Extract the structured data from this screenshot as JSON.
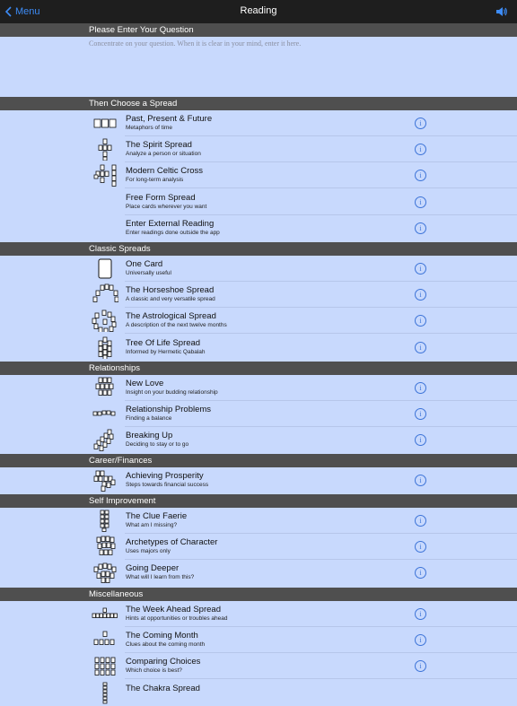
{
  "nav": {
    "back_label": "Menu",
    "title": "Reading"
  },
  "question": {
    "header": "Please Enter Your Question",
    "placeholder": "Concentrate on your question. When it is clear in your mind, enter it here.",
    "value": ""
  },
  "info_glyph": "i",
  "sections": [
    {
      "key": "spread",
      "title": "Then Choose a Spread",
      "items": [
        {
          "key": "past-present-future",
          "title": "Past, Present & Future",
          "subtitle": "Metaphors of time",
          "icon": "three-cards-icon"
        },
        {
          "key": "spirit",
          "title": "The Spirit Spread",
          "subtitle": "Analyze a person or situation",
          "icon": "spirit-spread-icon"
        },
        {
          "key": "celtic-cross",
          "title": "Modern Celtic Cross",
          "subtitle": "For long-term analysis",
          "icon": "celtic-cross-icon"
        },
        {
          "key": "free-form",
          "title": "Free Form Spread",
          "subtitle": "Place cards wherever you want",
          "icon": ""
        },
        {
          "key": "external",
          "title": "Enter External Reading",
          "subtitle": "Enter readings done outside the app",
          "icon": ""
        }
      ]
    },
    {
      "key": "classic",
      "title": "Classic Spreads",
      "items": [
        {
          "key": "one-card",
          "title": "One Card",
          "subtitle": "Universally useful",
          "icon": "single-card-icon"
        },
        {
          "key": "horseshoe",
          "title": "The Horseshoe Spread",
          "subtitle": "A classic and very versatile spread",
          "icon": "horseshoe-icon"
        },
        {
          "key": "astrological",
          "title": "The Astrological Spread",
          "subtitle": "A description of the next twelve months",
          "icon": "astrological-circle-icon"
        },
        {
          "key": "tree-of-life",
          "title": "Tree Of Life Spread",
          "subtitle": "Informed by Hermetic Qabalah",
          "icon": "tree-of-life-icon"
        }
      ]
    },
    {
      "key": "relationships",
      "title": "Relationships",
      "items": [
        {
          "key": "new-love",
          "title": "New Love",
          "subtitle": "Insight on your budding relationship",
          "icon": "new-love-icon"
        },
        {
          "key": "relationship-problems",
          "title": "Relationship Problems",
          "subtitle": "Finding a balance",
          "icon": "relationship-problems-icon"
        },
        {
          "key": "breaking-up",
          "title": "Breaking Up",
          "subtitle": "Deciding to stay or to go",
          "icon": "breaking-up-icon"
        }
      ]
    },
    {
      "key": "career",
      "title": "Career/Finances",
      "items": [
        {
          "key": "prosperity",
          "title": "Achieving Prosperity",
          "subtitle": "Steps towards financial success",
          "icon": "prosperity-icon"
        }
      ]
    },
    {
      "key": "self",
      "title": "Self Improvement",
      "items": [
        {
          "key": "clue-faerie",
          "title": "The Clue Faerie",
          "subtitle": "What am I missing?",
          "icon": "clue-faerie-icon"
        },
        {
          "key": "archetypes",
          "title": "Archetypes of Character",
          "subtitle": "Uses majors only",
          "icon": "archetypes-icon"
        },
        {
          "key": "going-deeper",
          "title": "Going Deeper",
          "subtitle": "What will I learn from this?",
          "icon": "going-deeper-icon"
        }
      ]
    },
    {
      "key": "misc",
      "title": "Miscellaneous",
      "items": [
        {
          "key": "week-ahead",
          "title": "The Week Ahead Spread",
          "subtitle": "Hints at opportunities or troubles ahead",
          "icon": "week-ahead-icon"
        },
        {
          "key": "coming-month",
          "title": "The Coming Month",
          "subtitle": "Clues about the coming month",
          "icon": "coming-month-icon"
        },
        {
          "key": "comparing-choices",
          "title": "Comparing Choices",
          "subtitle": "Which choice is best?",
          "icon": "comparing-choices-icon"
        },
        {
          "key": "chakra",
          "title": "The Chakra Spread",
          "subtitle": "",
          "icon": "chakra-icon"
        }
      ]
    }
  ]
}
